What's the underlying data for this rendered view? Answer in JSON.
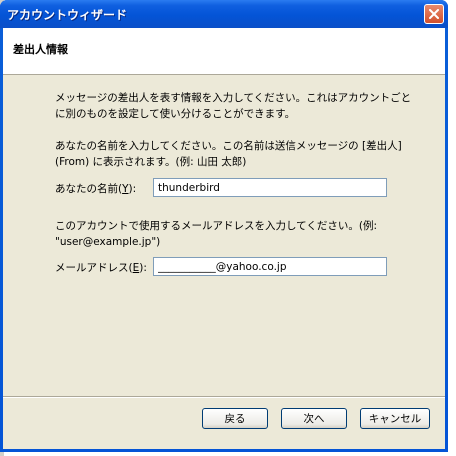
{
  "window": {
    "title": "アカウントウィザード",
    "close_icon": "close-icon"
  },
  "header": {
    "title": "差出人情報"
  },
  "content": {
    "intro": "メッセージの差出人を表す情報を入力してください。これはアカウントごとに別のものを設定して使い分けることができます。",
    "name_prompt": "あなたの名前を入力してください。この名前は送信メッセージの [差出人] (From) に表示されます。(例: 山田 太郎)",
    "name_label": "あなたの名前(",
    "name_accel": "Y",
    "name_label_end": "):",
    "name_value": "thunderbird",
    "mail_prompt": "このアカウントで使用するメールアドレスを入力してください。(例: \"user@example.jp\")",
    "mail_label": "メールアドレス(",
    "mail_accel": "E",
    "mail_label_end": "):",
    "mail_value": "___________@yahoo.co.jp"
  },
  "buttons": {
    "back": "戻る",
    "next": "次へ",
    "cancel": "キャンセル"
  },
  "colors": {
    "titlebar": "#0454d6",
    "client_bg": "#ece9d8",
    "close_button": "#d2502c"
  }
}
